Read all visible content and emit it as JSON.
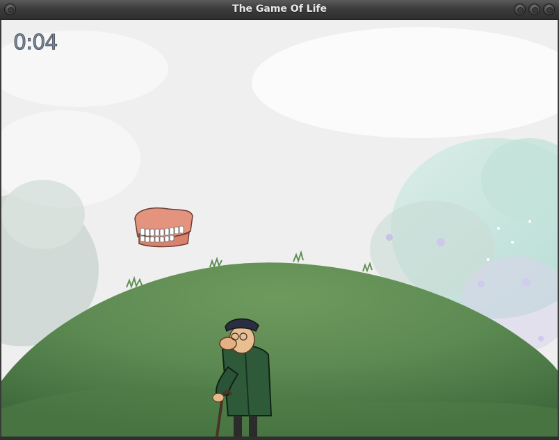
{
  "window": {
    "title": "The Game Of Life",
    "buttons": [
      "minimize-button",
      "maximize-button",
      "close-button"
    ]
  },
  "hud": {
    "timer": "0:04"
  },
  "scene": {
    "sky_color": "#efefef",
    "hill_color": "#5a8a52",
    "objects": [
      "dentures",
      "old-man-with-cane"
    ]
  }
}
